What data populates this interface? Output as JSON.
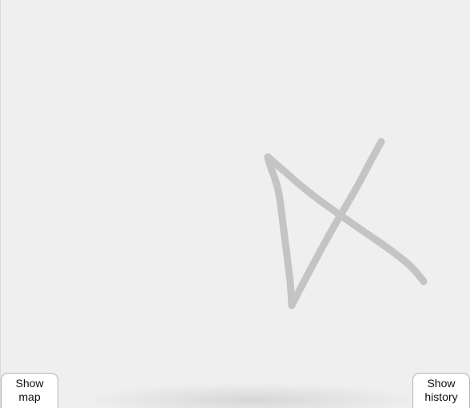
{
  "buttons": {
    "show_map": {
      "line1": "Show",
      "line2": "map"
    },
    "show_history": {
      "line1": "Show",
      "line2": "history"
    }
  },
  "drawing": {
    "stroke_color": "#c4c4c4",
    "background_color": "#efefef",
    "description_icon": "hand-drawn-stroke"
  }
}
